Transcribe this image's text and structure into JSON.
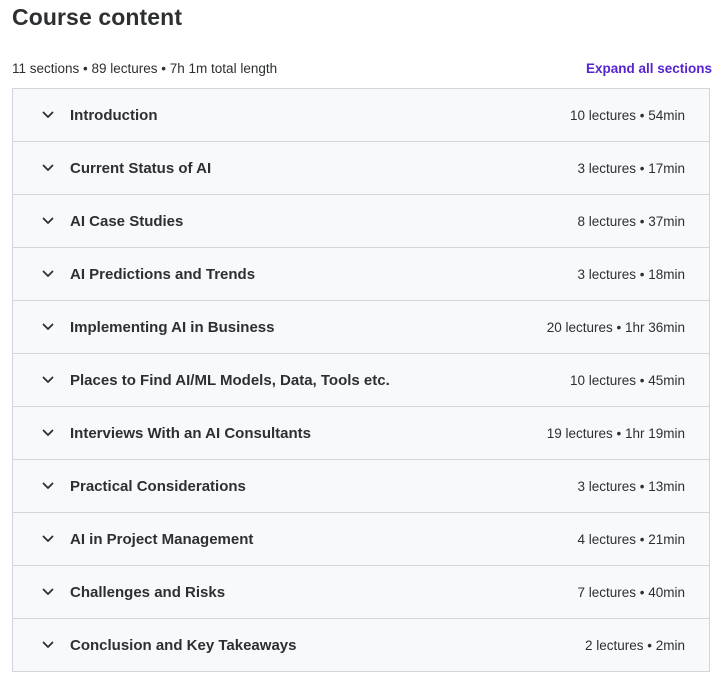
{
  "course_content": {
    "title": "Course content",
    "summary": "11 sections • 89 lectures • 7h 1m total length",
    "expand_all_label": "Expand all sections",
    "accent_color": "#5624d0",
    "sections": [
      {
        "title": "Introduction",
        "meta": "10 lectures • 54min",
        "icon": "chevron-down-icon"
      },
      {
        "title": "Current Status of AI",
        "meta": "3 lectures • 17min",
        "icon": "chevron-down-icon"
      },
      {
        "title": "AI Case Studies",
        "meta": "8 lectures • 37min",
        "icon": "chevron-down-icon"
      },
      {
        "title": "AI Predictions and Trends",
        "meta": "3 lectures • 18min",
        "icon": "chevron-down-icon"
      },
      {
        "title": "Implementing AI in Business",
        "meta": "20 lectures • 1hr 36min",
        "icon": "chevron-down-icon"
      },
      {
        "title": "Places to Find AI/ML Models, Data, Tools etc.",
        "meta": "10 lectures • 45min",
        "icon": "chevron-down-icon"
      },
      {
        "title": "Interviews With an AI Consultants",
        "meta": "19 lectures • 1hr 19min",
        "icon": "chevron-down-icon"
      },
      {
        "title": "Practical Considerations",
        "meta": "3 lectures • 13min",
        "icon": "chevron-down-icon"
      },
      {
        "title": "AI in Project Management",
        "meta": "4 lectures • 21min",
        "icon": "chevron-down-icon"
      },
      {
        "title": "Challenges and Risks",
        "meta": "7 lectures • 40min",
        "icon": "chevron-down-icon"
      },
      {
        "title": "Conclusion and Key Takeaways",
        "meta": "2 lectures • 2min",
        "icon": "chevron-down-icon"
      }
    ]
  }
}
